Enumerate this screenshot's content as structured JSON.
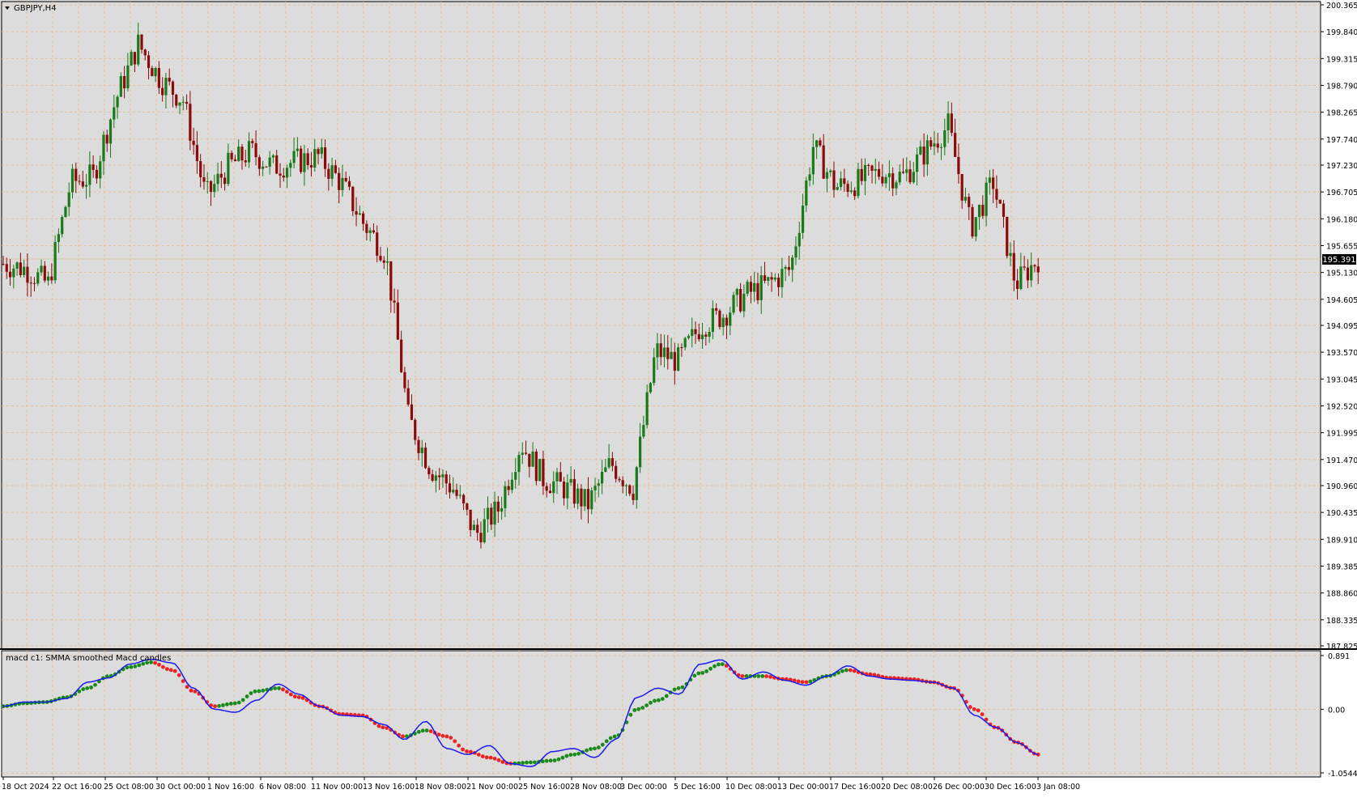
{
  "symbol": {
    "label": "GBPJPY,H4",
    "menu_icon": "triangle-down-icon"
  },
  "price_axis": {
    "labels": [
      "200.365",
      "199.840",
      "199.315",
      "198.790",
      "198.265",
      "197.740",
      "197.230",
      "196.705",
      "196.180",
      "195.655",
      "195.130",
      "194.605",
      "194.095",
      "193.570",
      "193.045",
      "192.520",
      "191.995",
      "191.470",
      "190.960",
      "190.435",
      "189.910",
      "189.385",
      "188.860",
      "188.335",
      "187.825"
    ],
    "current_price": "195.391"
  },
  "indicator": {
    "title": "macd c1: SMMA smoothed Macd candles",
    "axis_labels": [
      "0.891",
      "0.00",
      "-1.0544"
    ]
  },
  "time_axis": {
    "labels": [
      "18 Oct 2024",
      "22 Oct 16:00",
      "25 Oct 08:00",
      "30 Oct 00:00",
      "1 Nov 16:00",
      "6 Nov 08:00",
      "11 Nov 00:00",
      "13 Nov 16:00",
      "18 Nov 08:00",
      "21 Nov 00:00",
      "25 Nov 16:00",
      "28 Nov 08:00",
      "3 Dec 00:00",
      "5 Dec 16:00",
      "10 Dec 08:00",
      "13 Dec 00:00",
      "17 Dec 16:00",
      "20 Dec 08:00",
      "26 Dec 00:00",
      "30 Dec 16:00",
      "3 Jan 08:00"
    ]
  },
  "colors": {
    "background": "#dcdcdc",
    "grid": "#e8b98a",
    "bull": "#1a7a1a",
    "bear": "#8b0a0a",
    "macd_line": "#1a1aee",
    "signal_up": "#1a8a1a",
    "signal_down": "#ee2222",
    "price_line": "#d8c7a4"
  },
  "chart_data": [
    {
      "type": "candlestick",
      "title": "GBPJPY,H4",
      "ylim": [
        187.825,
        200.365
      ],
      "x_labels": [
        "18 Oct 2024",
        "22 Oct 16:00",
        "25 Oct 08:00",
        "30 Oct 00:00",
        "1 Nov 16:00",
        "6 Nov 08:00",
        "11 Nov 00:00",
        "13 Nov 16:00",
        "18 Nov 08:00",
        "21 Nov 00:00",
        "25 Nov 16:00",
        "28 Nov 08:00",
        "3 Dec 00:00",
        "5 Dec 16:00",
        "10 Dec 08:00",
        "13 Dec 00:00",
        "17 Dec 16:00",
        "20 Dec 08:00",
        "26 Dec 00:00",
        "30 Dec 16:00",
        "3 Jan 08:00"
      ],
      "close_path": [
        [
          0,
          195.3
        ],
        [
          1,
          195.2
        ],
        [
          2,
          194.9
        ],
        [
          3,
          196.9
        ],
        [
          4,
          197.0
        ],
        [
          5,
          198.5
        ],
        [
          6,
          199.6
        ],
        [
          7,
          198.9
        ],
        [
          8,
          198.5
        ],
        [
          9,
          196.6
        ],
        [
          10,
          197.2
        ],
        [
          11,
          197.5
        ],
        [
          12,
          197.2
        ],
        [
          13,
          197.3
        ],
        [
          14,
          197.4
        ],
        [
          15,
          196.9
        ],
        [
          16,
          196.1
        ],
        [
          17,
          195.5
        ],
        [
          18,
          192.3
        ],
        [
          19,
          191.3
        ],
        [
          20,
          190.9
        ],
        [
          21,
          190.0
        ],
        [
          22,
          190.5
        ],
        [
          23,
          191.8
        ],
        [
          24,
          191.1
        ],
        [
          25,
          190.9
        ],
        [
          26,
          190.6
        ],
        [
          27,
          191.4
        ],
        [
          28,
          190.9
        ],
        [
          29,
          193.6
        ],
        [
          30,
          193.4
        ],
        [
          31,
          194.1
        ],
        [
          32,
          194.3
        ],
        [
          33,
          194.7
        ],
        [
          34,
          194.9
        ],
        [
          35,
          195.2
        ],
        [
          36,
          197.6
        ],
        [
          37,
          196.8
        ],
        [
          38,
          196.9
        ],
        [
          39,
          197.1
        ],
        [
          40,
          197.0
        ],
        [
          41,
          197.5
        ],
        [
          42,
          198.0
        ],
        [
          43,
          196.0
        ],
        [
          44,
          196.9
        ],
        [
          45,
          194.9
        ],
        [
          46,
          195.4
        ]
      ]
    },
    {
      "type": "line",
      "title": "macd c1: SMMA smoothed Macd candles",
      "ylim": [
        -1.0544,
        0.891
      ],
      "series": [
        {
          "values": [
            0.05,
            0.12,
            0.12,
            0.18,
            0.45,
            0.52,
            0.75,
            0.83,
            0.77,
            0.35,
            0.0,
            -0.05,
            0.15,
            0.42,
            0.25,
            0.05,
            -0.1,
            -0.12,
            -0.25,
            -0.5,
            -0.2,
            -0.65,
            -0.75,
            -0.6,
            -0.9,
            -0.95,
            -0.7,
            -0.65,
            -0.8,
            -0.5,
            0.2,
            0.35,
            0.25,
            0.75,
            0.82,
            0.5,
            0.62,
            0.48,
            0.4,
            0.55,
            0.72,
            0.55,
            0.5,
            0.48,
            0.45,
            0.35,
            -0.1,
            -0.3,
            -0.55,
            -0.75
          ]
        },
        {
          "values": [
            0.05,
            0.1,
            0.12,
            0.2,
            0.35,
            0.55,
            0.7,
            0.78,
            0.65,
            0.3,
            0.05,
            0.1,
            0.3,
            0.35,
            0.2,
            0.05,
            -0.08,
            -0.1,
            -0.3,
            -0.45,
            -0.35,
            -0.45,
            -0.7,
            -0.8,
            -0.9,
            -0.88,
            -0.85,
            -0.75,
            -0.65,
            -0.45,
            0.0,
            0.15,
            0.35,
            0.6,
            0.75,
            0.55,
            0.55,
            0.5,
            0.45,
            0.55,
            0.65,
            0.58,
            0.52,
            0.5,
            0.45,
            0.35,
            0.0,
            -0.3,
            -0.55,
            -0.75
          ]
        }
      ]
    }
  ]
}
